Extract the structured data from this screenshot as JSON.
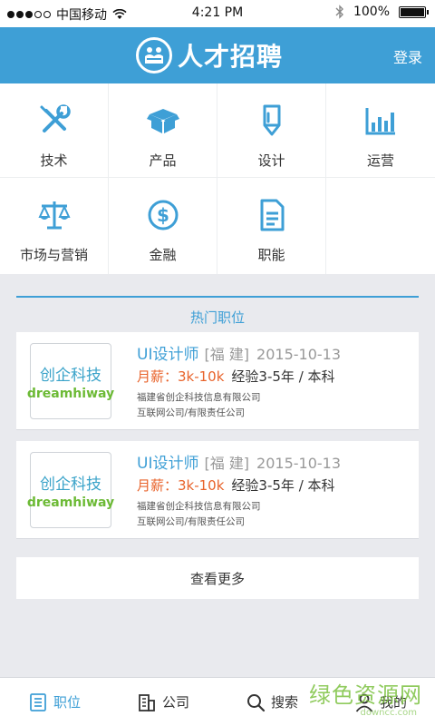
{
  "status_bar": {
    "carrier": "中国移动",
    "time": "4:21 PM",
    "battery": "100%"
  },
  "header": {
    "title": "人才招聘",
    "login": "登录"
  },
  "categories": [
    {
      "label": "技术",
      "icon": "wrench-screwdriver-icon"
    },
    {
      "label": "产品",
      "icon": "box-icon"
    },
    {
      "label": "设计",
      "icon": "pen-icon"
    },
    {
      "label": "运营",
      "icon": "bar-chart-icon"
    },
    {
      "label": "市场与营销",
      "icon": "balance-scale-icon"
    },
    {
      "label": "金融",
      "icon": "dollar-coin-icon"
    },
    {
      "label": "职能",
      "icon": "document-icon"
    }
  ],
  "hot_jobs": {
    "title": "热门职位",
    "items": [
      {
        "logo_cn": "创企科技",
        "logo_en": "dreamhiway",
        "title": "UI设计师",
        "location": "[福 建]",
        "date": "2015-10-13",
        "salary": "月薪：3k-10k",
        "experience": "经验3-5年 / 本科",
        "company": "福建省创企科技信息有限公司",
        "company_type": "互联网公司/有限责任公司"
      },
      {
        "logo_cn": "创企科技",
        "logo_en": "dreamhiway",
        "title": "UI设计师",
        "location": "[福 建]",
        "date": "2015-10-13",
        "salary": "月薪：3k-10k",
        "experience": "经验3-5年 / 本科",
        "company": "福建省创企科技信息有限公司",
        "company_type": "互联网公司/有限责任公司"
      }
    ],
    "more": "查看更多"
  },
  "tabs": [
    {
      "label": "职位",
      "icon": "list-icon",
      "active": true
    },
    {
      "label": "公司",
      "icon": "building-icon",
      "active": false
    },
    {
      "label": "搜索",
      "icon": "search-icon",
      "active": false
    },
    {
      "label": "我的",
      "icon": "user-icon",
      "active": false
    }
  ],
  "watermark": {
    "text": "绿色资源网",
    "url": "downcc.com"
  },
  "colors": {
    "accent": "#3e9fd6",
    "salary": "#e8632b",
    "background": "#e9eaee"
  }
}
